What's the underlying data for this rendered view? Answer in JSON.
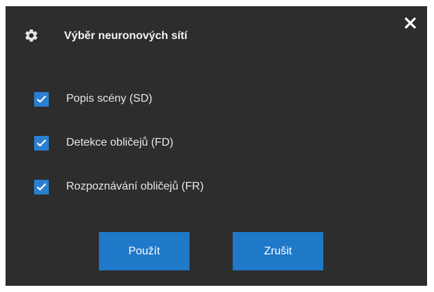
{
  "dialog": {
    "title": "Výběr neuronových sítí",
    "title_icon": "gear-icon",
    "close_icon": "close-icon",
    "options": [
      {
        "label": "Popis scény (SD)",
        "checked": true
      },
      {
        "label": "Detekce obličejů (FD)",
        "checked": true
      },
      {
        "label": "Rozpoznávání obličejů (FR)",
        "checked": true
      }
    ],
    "buttons": {
      "apply_label": "Použít",
      "cancel_label": "Zrušit"
    }
  },
  "colors": {
    "background": "#2d2d2d",
    "accent": "#1f78c8",
    "checkbox": "#2a7fd1",
    "text": "#e8e8e8"
  }
}
